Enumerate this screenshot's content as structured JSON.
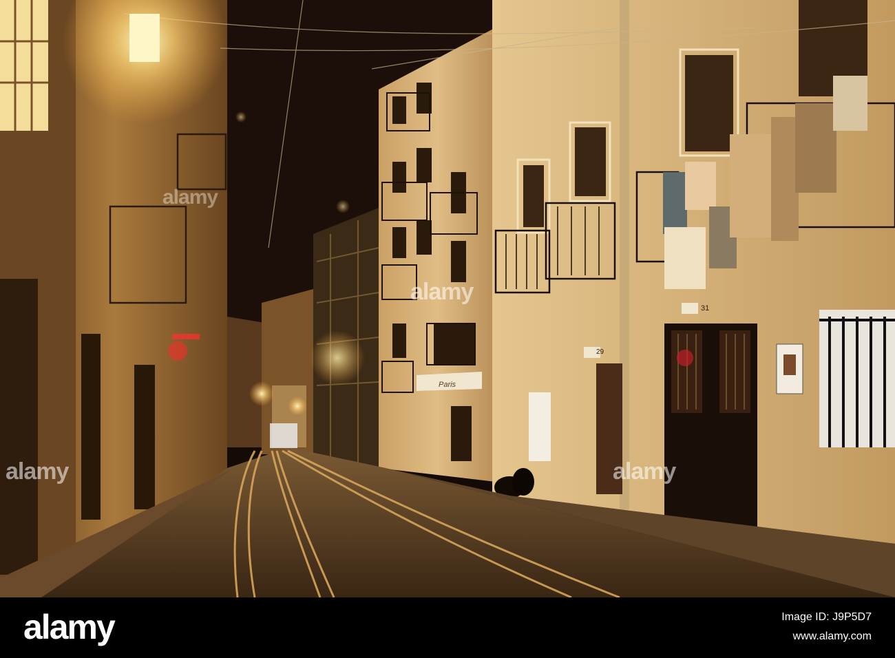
{
  "watermark": {
    "text": "alamy",
    "color": "#ffffff"
  },
  "footer": {
    "logo": "alamy",
    "image_id": "Image ID: J9P5D7",
    "url": "www.alamy.com",
    "background": "#000000"
  },
  "signs": {
    "shop_sign": "Paris",
    "door_number_right": "31",
    "door_number_mid": "29"
  },
  "colors": {
    "sky": "#140a06",
    "wall_lit": "#e6c48a",
    "lamp": "#fff2b0",
    "cobble": "#5a3f24"
  }
}
